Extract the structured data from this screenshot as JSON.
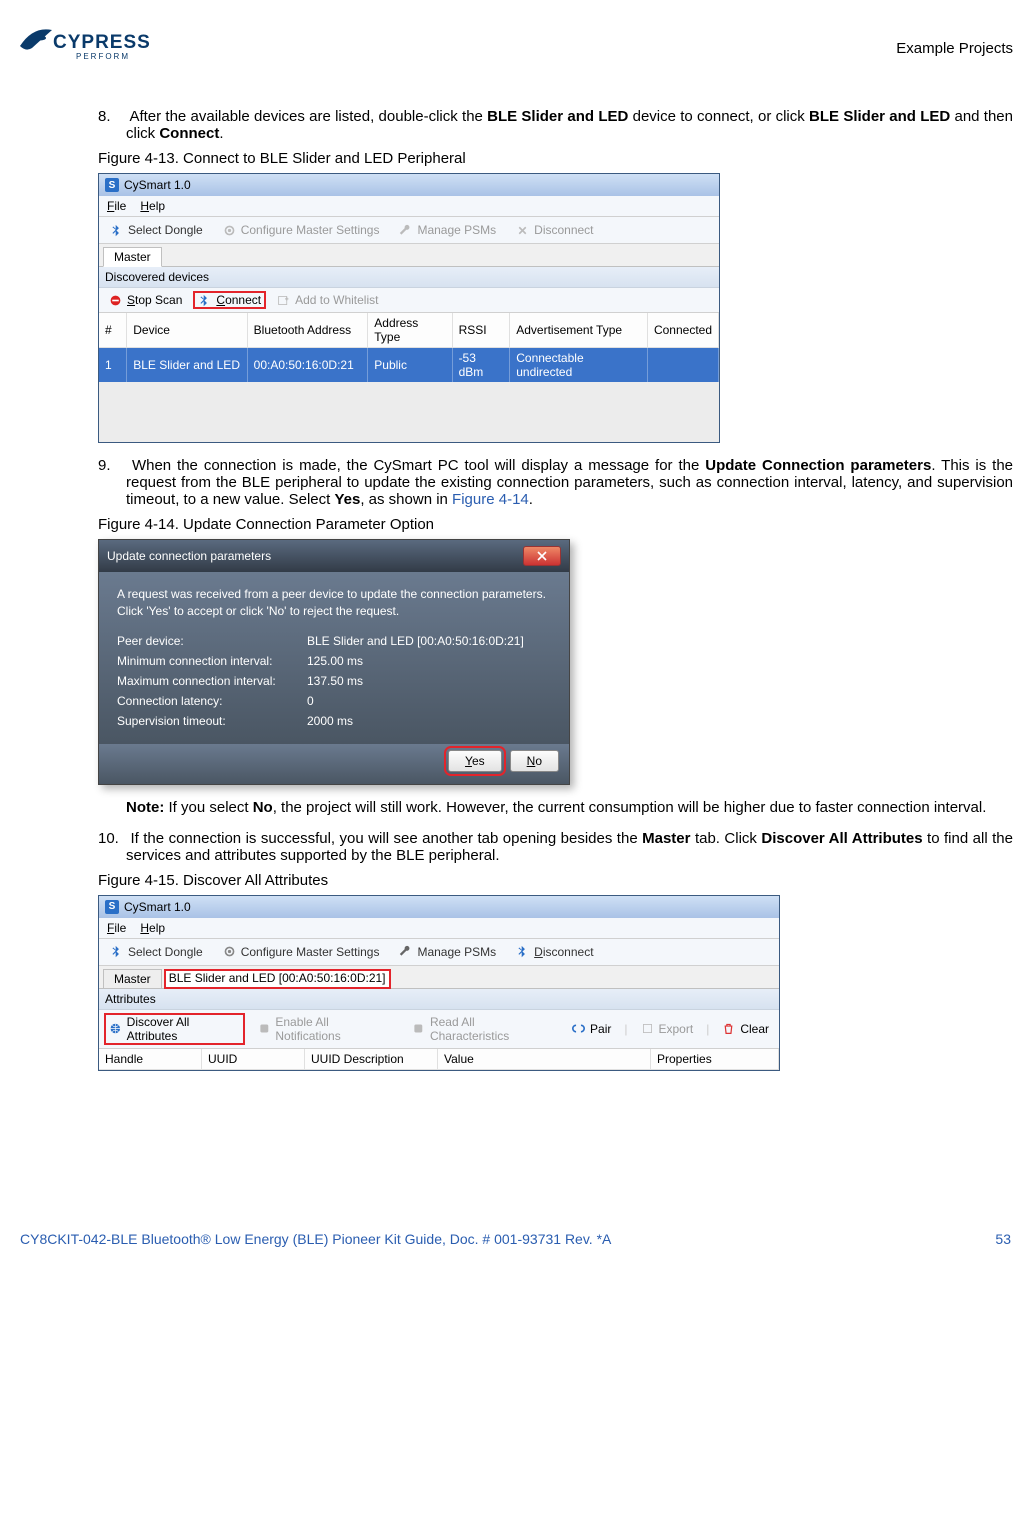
{
  "header": {
    "logo_main": "CYPRESS",
    "logo_sub": "PERFORM",
    "section": "Example Projects"
  },
  "steps": {
    "s8": {
      "num": "8.",
      "text_pre": "After the available devices are listed, double-click the ",
      "bold1": "BLE Slider and LED",
      "text_mid": " device to connect, or click ",
      "bold2": "BLE Slider and LED",
      "text_mid2": " and then click ",
      "bold3": "Connect",
      "text_end": "."
    },
    "s9": {
      "num": "9.",
      "text_pre": "When the connection is made, the CySmart PC tool will display a message for the ",
      "bold1": "Update Connection parameters",
      "text_mid": ". This is the request from the BLE peripheral to update the existing connection parameters, such as connection interval, latency, and supervision timeout, to a new value. Select ",
      "bold2": "Yes",
      "text_mid2": ", as shown in ",
      "link": "Figure 4-14",
      "text_end": "."
    },
    "note": {
      "bold1": "Note:",
      "text_pre": " If you select ",
      "bold2": "No",
      "text_end": ", the project will still work. However, the current consumption will be higher due to faster connection interval."
    },
    "s10": {
      "num": "10.",
      "text_pre": "If the connection is successful, you will see another tab opening besides the ",
      "bold1": "Master",
      "text_mid": " tab. Click ",
      "bold2": "Discover All Attributes",
      "text_end": " to find all the services and attributes supported by the BLE peripheral."
    }
  },
  "fig13": {
    "caption": "Figure 4-13.  Connect to BLE Slider and LED Peripheral",
    "title": "CySmart 1.0",
    "menu_file": "File",
    "menu_help": "Help",
    "tb_select": "Select Dongle",
    "tb_config": "Configure Master Settings",
    "tb_psm": "Manage PSMs",
    "tb_disc": "Disconnect",
    "tab_master": "Master",
    "sub_discovered": "Discovered devices",
    "btn_stop": "Stop Scan",
    "btn_connect": "Connect",
    "btn_whitelist": "Add to Whitelist",
    "cols": {
      "hash": "#",
      "device": "Device",
      "addr": "Bluetooth Address",
      "atype": "Address Type",
      "rssi": "RSSI",
      "advtype": "Advertisement Type",
      "conn": "Connected"
    },
    "row": {
      "hash": "1",
      "device": "BLE Slider and LED",
      "addr": "00:A0:50:16:0D:21",
      "atype": "Public",
      "rssi": "-53 dBm",
      "advtype": "Connectable undirected",
      "conn": ""
    }
  },
  "fig14": {
    "caption": "Figure 4-14.  Update Connection Parameter Option",
    "title": "Update connection parameters",
    "msg": "A request was received from a peer device to update the connection parameters. Click 'Yes' to accept or click 'No' to reject the request.",
    "rows": {
      "peer_k": "Peer device:",
      "peer_v": "BLE Slider and LED [00:A0:50:16:0D:21]",
      "min_k": "Minimum connection interval:",
      "min_v": "125.00 ms",
      "max_k": "Maximum connection interval:",
      "max_v": "137.50 ms",
      "lat_k": "Connection latency:",
      "lat_v": "0",
      "sup_k": "Supervision timeout:",
      "sup_v": "2000 ms"
    },
    "yes": "Yes",
    "no": "No"
  },
  "fig15": {
    "caption": "Figure 4-15.  Discover All Attributes",
    "title": "CySmart 1.0",
    "menu_file": "File",
    "menu_help": "Help",
    "tb_select": "Select Dongle",
    "tb_config": "Configure Master Settings",
    "tb_psm": "Manage PSMs",
    "tb_disc": "Disconnect",
    "tab_master": "Master",
    "tab_device": "BLE Slider and LED [00:A0:50:16:0D:21]",
    "sub_attr": "Attributes",
    "btn_discover": "Discover All Attributes",
    "btn_enable": "Enable All Notifications",
    "btn_read": "Read All Characteristics",
    "btn_pair": "Pair",
    "btn_export": "Export",
    "btn_clear": "Clear",
    "cols": {
      "handle": "Handle",
      "uuid": "UUID",
      "uuiddesc": "UUID Description",
      "value": "Value",
      "props": "Properties"
    }
  },
  "footer": {
    "left": "CY8CKIT-042-BLE Bluetooth® Low Energy (BLE) Pioneer Kit Guide, Doc. # 001-93731 Rev. *A",
    "right": "53"
  }
}
